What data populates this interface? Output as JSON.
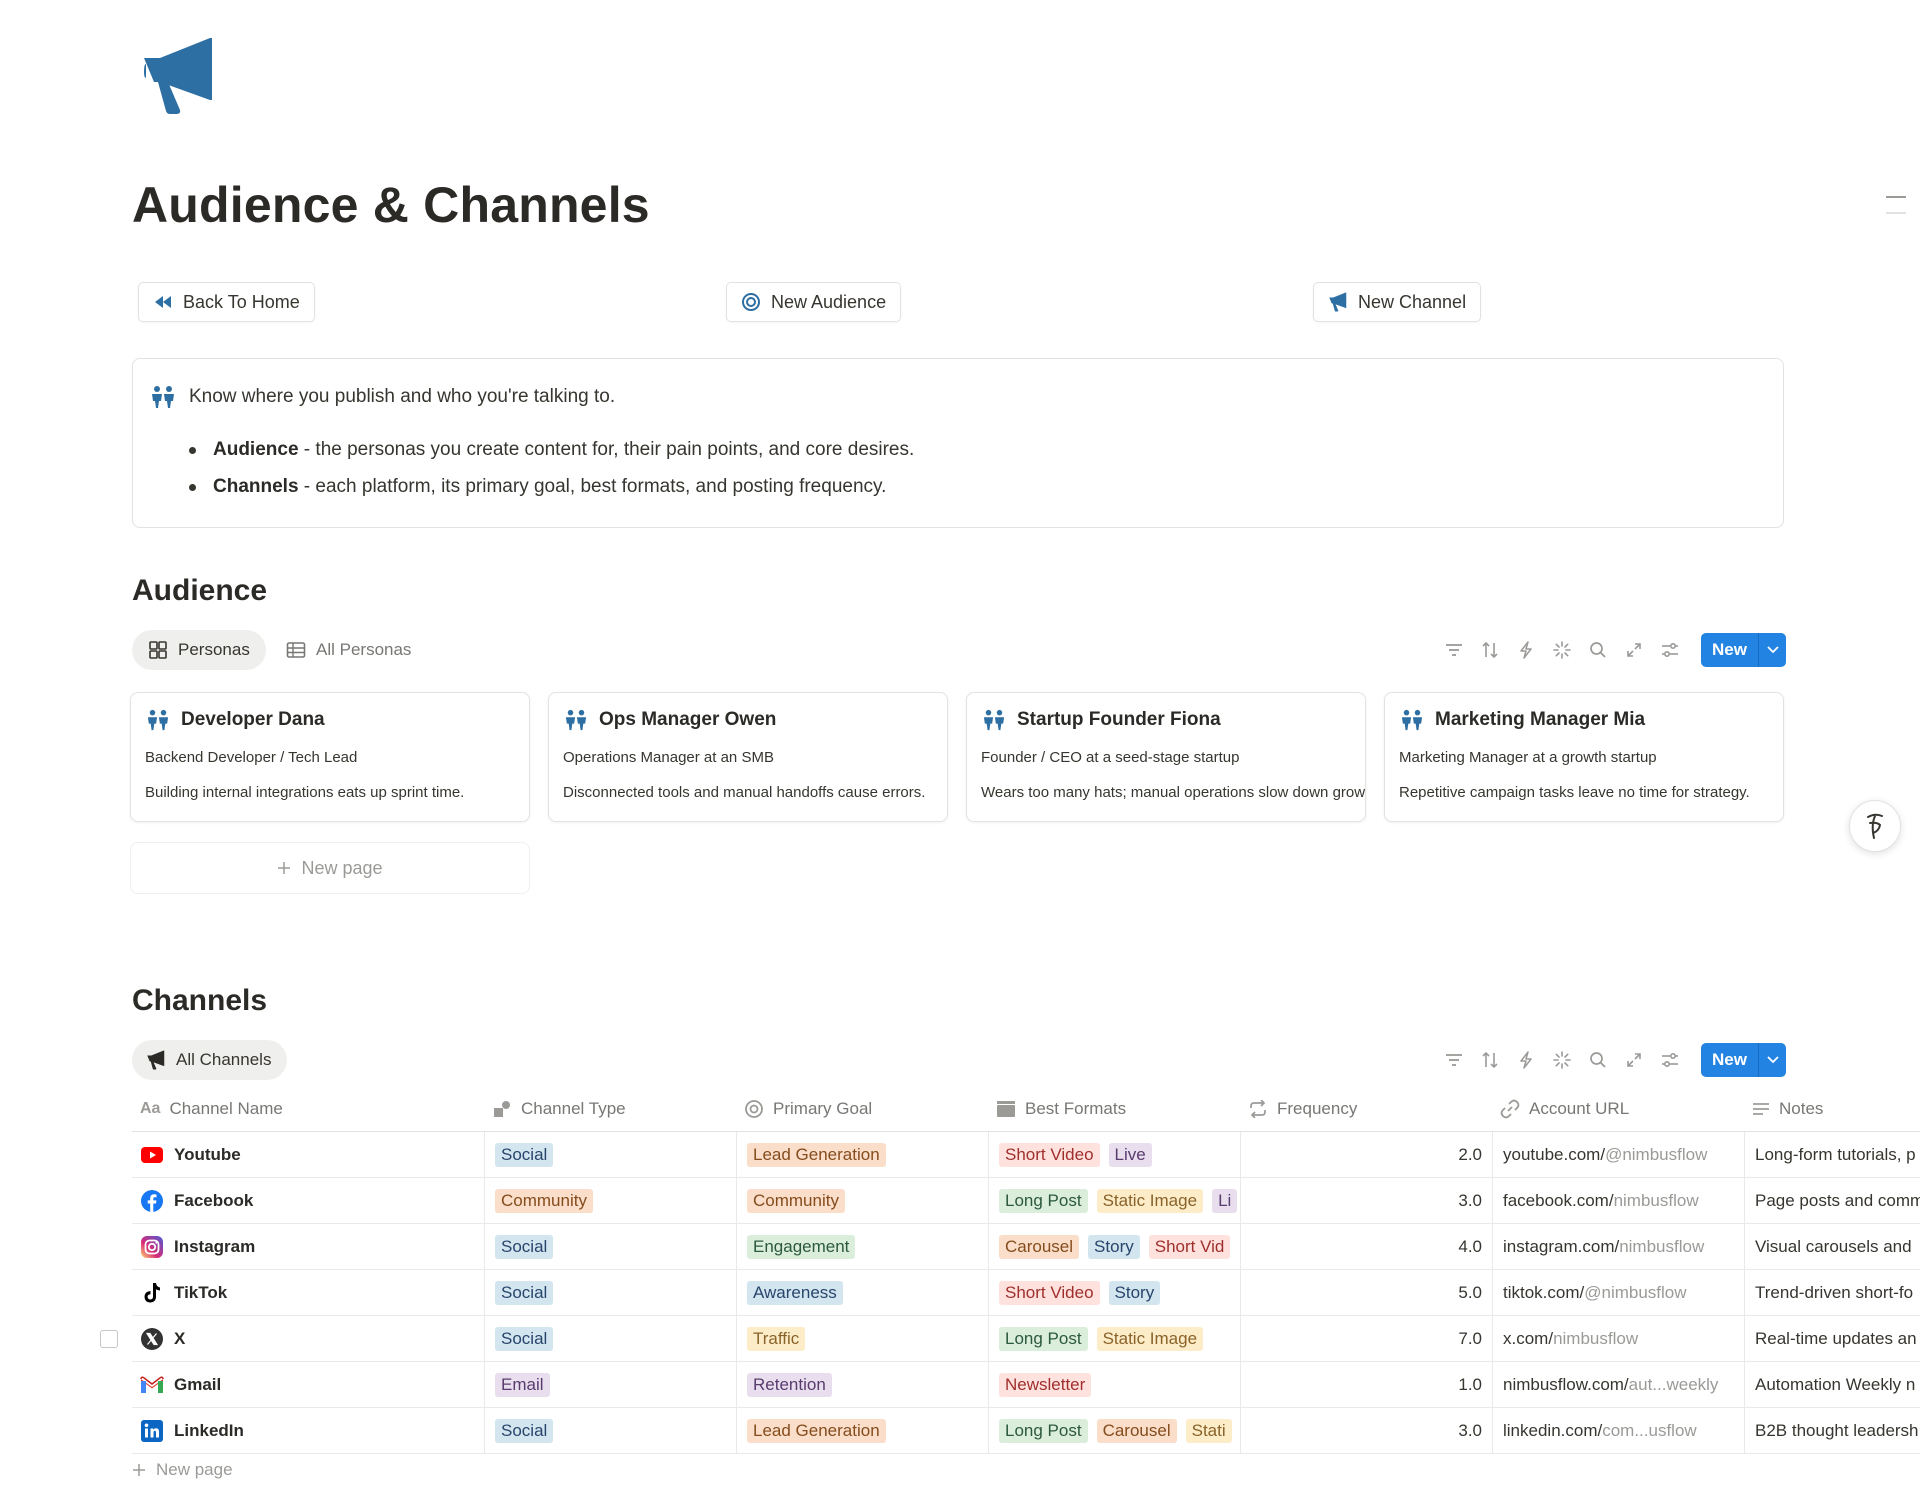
{
  "page": {
    "title": "Audience & Channels",
    "icon": "megaphone-icon"
  },
  "nav_buttons": [
    {
      "label": "Back To Home",
      "icon": "rewind-icon"
    },
    {
      "label": "New Audience",
      "icon": "target-icon"
    },
    {
      "label": "New Channel",
      "icon": "megaphone-icon"
    }
  ],
  "callout": {
    "icon": "people-icon",
    "text": "Know where you publish and who you're talking to.",
    "bullets": [
      {
        "term": "Audience",
        "desc": " - the personas you create content for, their pain points, and core desires."
      },
      {
        "term": "Channels",
        "desc": " - each platform, its primary goal, best formats, and posting frequency."
      }
    ]
  },
  "audience": {
    "title": "Audience",
    "views": [
      {
        "label": "Personas",
        "icon": "gallery-icon",
        "active": true
      },
      {
        "label": "All Personas",
        "icon": "table-icon",
        "active": false
      }
    ],
    "new_label": "New",
    "personas": [
      {
        "name": "Developer Dana",
        "role": "Backend Developer / Tech Lead",
        "pain": "Building internal integrations eats up sprint time."
      },
      {
        "name": "Ops Manager Owen",
        "role": "Operations Manager at an SMB",
        "pain": "Disconnected tools and manual handoffs cause errors."
      },
      {
        "name": "Startup Founder Fiona",
        "role": "Founder / CEO at a seed-stage startup",
        "pain": "Wears too many hats; manual operations slow down growth."
      },
      {
        "name": "Marketing Manager Mia",
        "role": "Marketing Manager at a growth startup",
        "pain": "Repetitive campaign tasks leave no time for strategy."
      }
    ],
    "new_page_label": "New page"
  },
  "channels": {
    "title": "Channels",
    "view_label": "All Channels",
    "new_label": "New",
    "columns": [
      {
        "label": "Channel Name",
        "icon": "text-aa-icon"
      },
      {
        "label": "Channel Type",
        "icon": "shapes-icon"
      },
      {
        "label": "Primary Goal",
        "icon": "target-icon"
      },
      {
        "label": "Best Formats",
        "icon": "clapperboard-icon"
      },
      {
        "label": "Frequency",
        "icon": "repeat-icon"
      },
      {
        "label": "Account URL",
        "icon": "link-icon"
      },
      {
        "label": "Notes",
        "icon": "lines-icon"
      }
    ],
    "rows": [
      {
        "name": "Youtube",
        "icon": "youtube-icon",
        "type": "Social",
        "goal": "Lead Generation",
        "formats": [
          "Short Video",
          "Live"
        ],
        "frequency": "2.0",
        "url_host": "youtube.com/",
        "url_path": "@nimbusflow",
        "notes": "Long-form tutorials, p"
      },
      {
        "name": "Facebook",
        "icon": "facebook-icon",
        "type": "Community",
        "goal": "Community",
        "formats": [
          "Long Post",
          "Static Image",
          "Li"
        ],
        "frequency": "3.0",
        "url_host": "facebook.com/",
        "url_path": "nimbusflow",
        "notes": "Page posts and comm"
      },
      {
        "name": "Instagram",
        "icon": "instagram-icon",
        "type": "Social",
        "goal": "Engagement",
        "formats": [
          "Carousel",
          "Story",
          "Short Vid"
        ],
        "frequency": "4.0",
        "url_host": "instagram.com/",
        "url_path": "nimbusflow",
        "notes": "Visual carousels and"
      },
      {
        "name": "TikTok",
        "icon": "tiktok-icon",
        "type": "Social",
        "goal": "Awareness",
        "formats": [
          "Short Video",
          "Story"
        ],
        "frequency": "5.0",
        "url_host": "tiktok.com/",
        "url_path": "@nimbusflow",
        "notes": "Trend-driven short-fo"
      },
      {
        "name": "X",
        "icon": "x-logo-icon",
        "type": "Social",
        "goal": "Traffic",
        "formats": [
          "Long Post",
          "Static Image"
        ],
        "frequency": "7.0",
        "url_host": "x.com/",
        "url_path": "nimbusflow",
        "notes": "Real-time updates an"
      },
      {
        "name": "Gmail",
        "icon": "gmail-icon",
        "type": "Email",
        "goal": "Retention",
        "formats": [
          "Newsletter"
        ],
        "frequency": "1.0",
        "url_host": "nimbusflow.com/",
        "url_path": "aut...weekly",
        "notes": "Automation Weekly n"
      },
      {
        "name": "LinkedIn",
        "icon": "linkedin-icon",
        "type": "Social",
        "goal": "Lead Generation",
        "formats": [
          "Long Post",
          "Carousel",
          "Stati"
        ],
        "frequency": "3.0",
        "url_host": "linkedin.com/",
        "url_path": "com...usflow",
        "notes": "B2B thought leadersh"
      }
    ],
    "new_page_label": "New page"
  },
  "tag_colors": {
    "Social": {
      "bg": "#d3e5ef",
      "fg": "#28456c"
    },
    "Community": {
      "bg": "#fadec9",
      "fg": "#854c1d"
    },
    "Email": {
      "bg": "#e8deee",
      "fg": "#5a3b6e"
    },
    "Lead Generation": {
      "bg": "#fadec9",
      "fg": "#854c1d"
    },
    "Engagement": {
      "bg": "#dbeddb",
      "fg": "#2b593f"
    },
    "Awareness": {
      "bg": "#d3e5ef",
      "fg": "#28456c"
    },
    "Traffic": {
      "bg": "#fdecc8",
      "fg": "#89632a"
    },
    "Retention": {
      "bg": "#e8deee",
      "fg": "#5a3b6e"
    },
    "Short Video": {
      "bg": "#ffe2dd",
      "fg": "#9f2f2d"
    },
    "Live": {
      "bg": "#e8deee",
      "fg": "#5a3b6e"
    },
    "Long Post": {
      "bg": "#dbeddb",
      "fg": "#2b593f"
    },
    "Static Image": {
      "bg": "#fdecc8",
      "fg": "#89632a"
    },
    "Li": {
      "bg": "#e8deee",
      "fg": "#5a3b6e"
    },
    "Carousel": {
      "bg": "#fadec9",
      "fg": "#854c1d"
    },
    "Story": {
      "bg": "#d3e5ef",
      "fg": "#28456c"
    },
    "Short Vid": {
      "bg": "#ffe2dd",
      "fg": "#9f2f2d"
    },
    "Newsletter": {
      "bg": "#ffe2dd",
      "fg": "#9f2f2d"
    },
    "Stati": {
      "bg": "#fdecc8",
      "fg": "#89632a"
    }
  },
  "accent_color": "#2383e2",
  "icon_color": "#2e6fa3"
}
